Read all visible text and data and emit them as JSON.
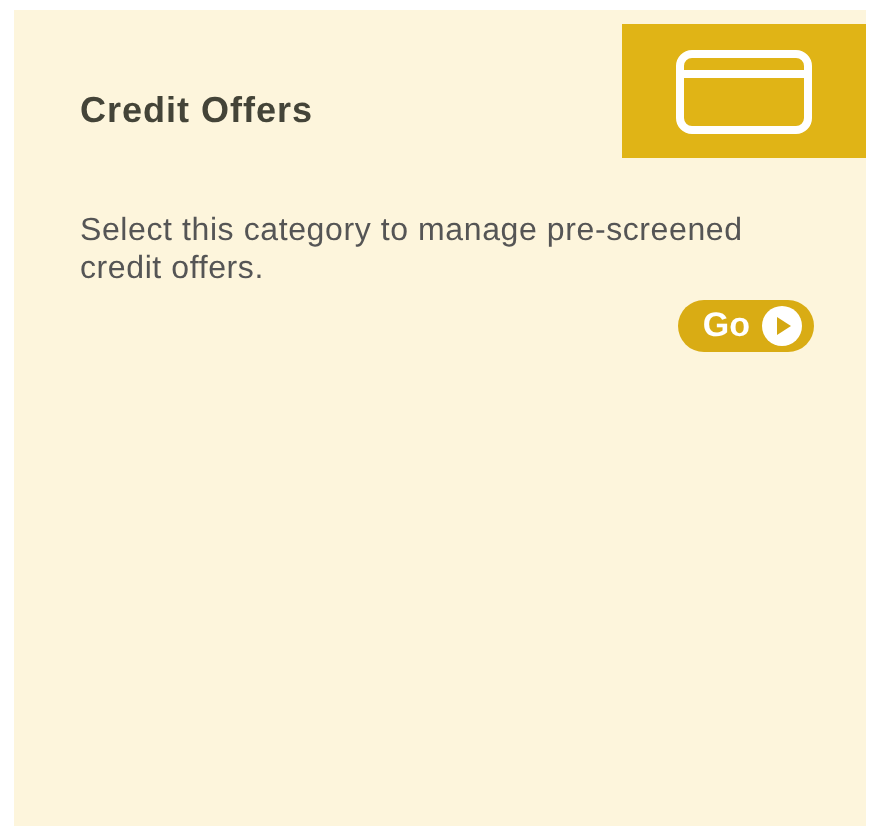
{
  "card": {
    "title": "Credit Offers",
    "description": "Select this category to manage pre-screened credit offers.",
    "button": "Go"
  }
}
